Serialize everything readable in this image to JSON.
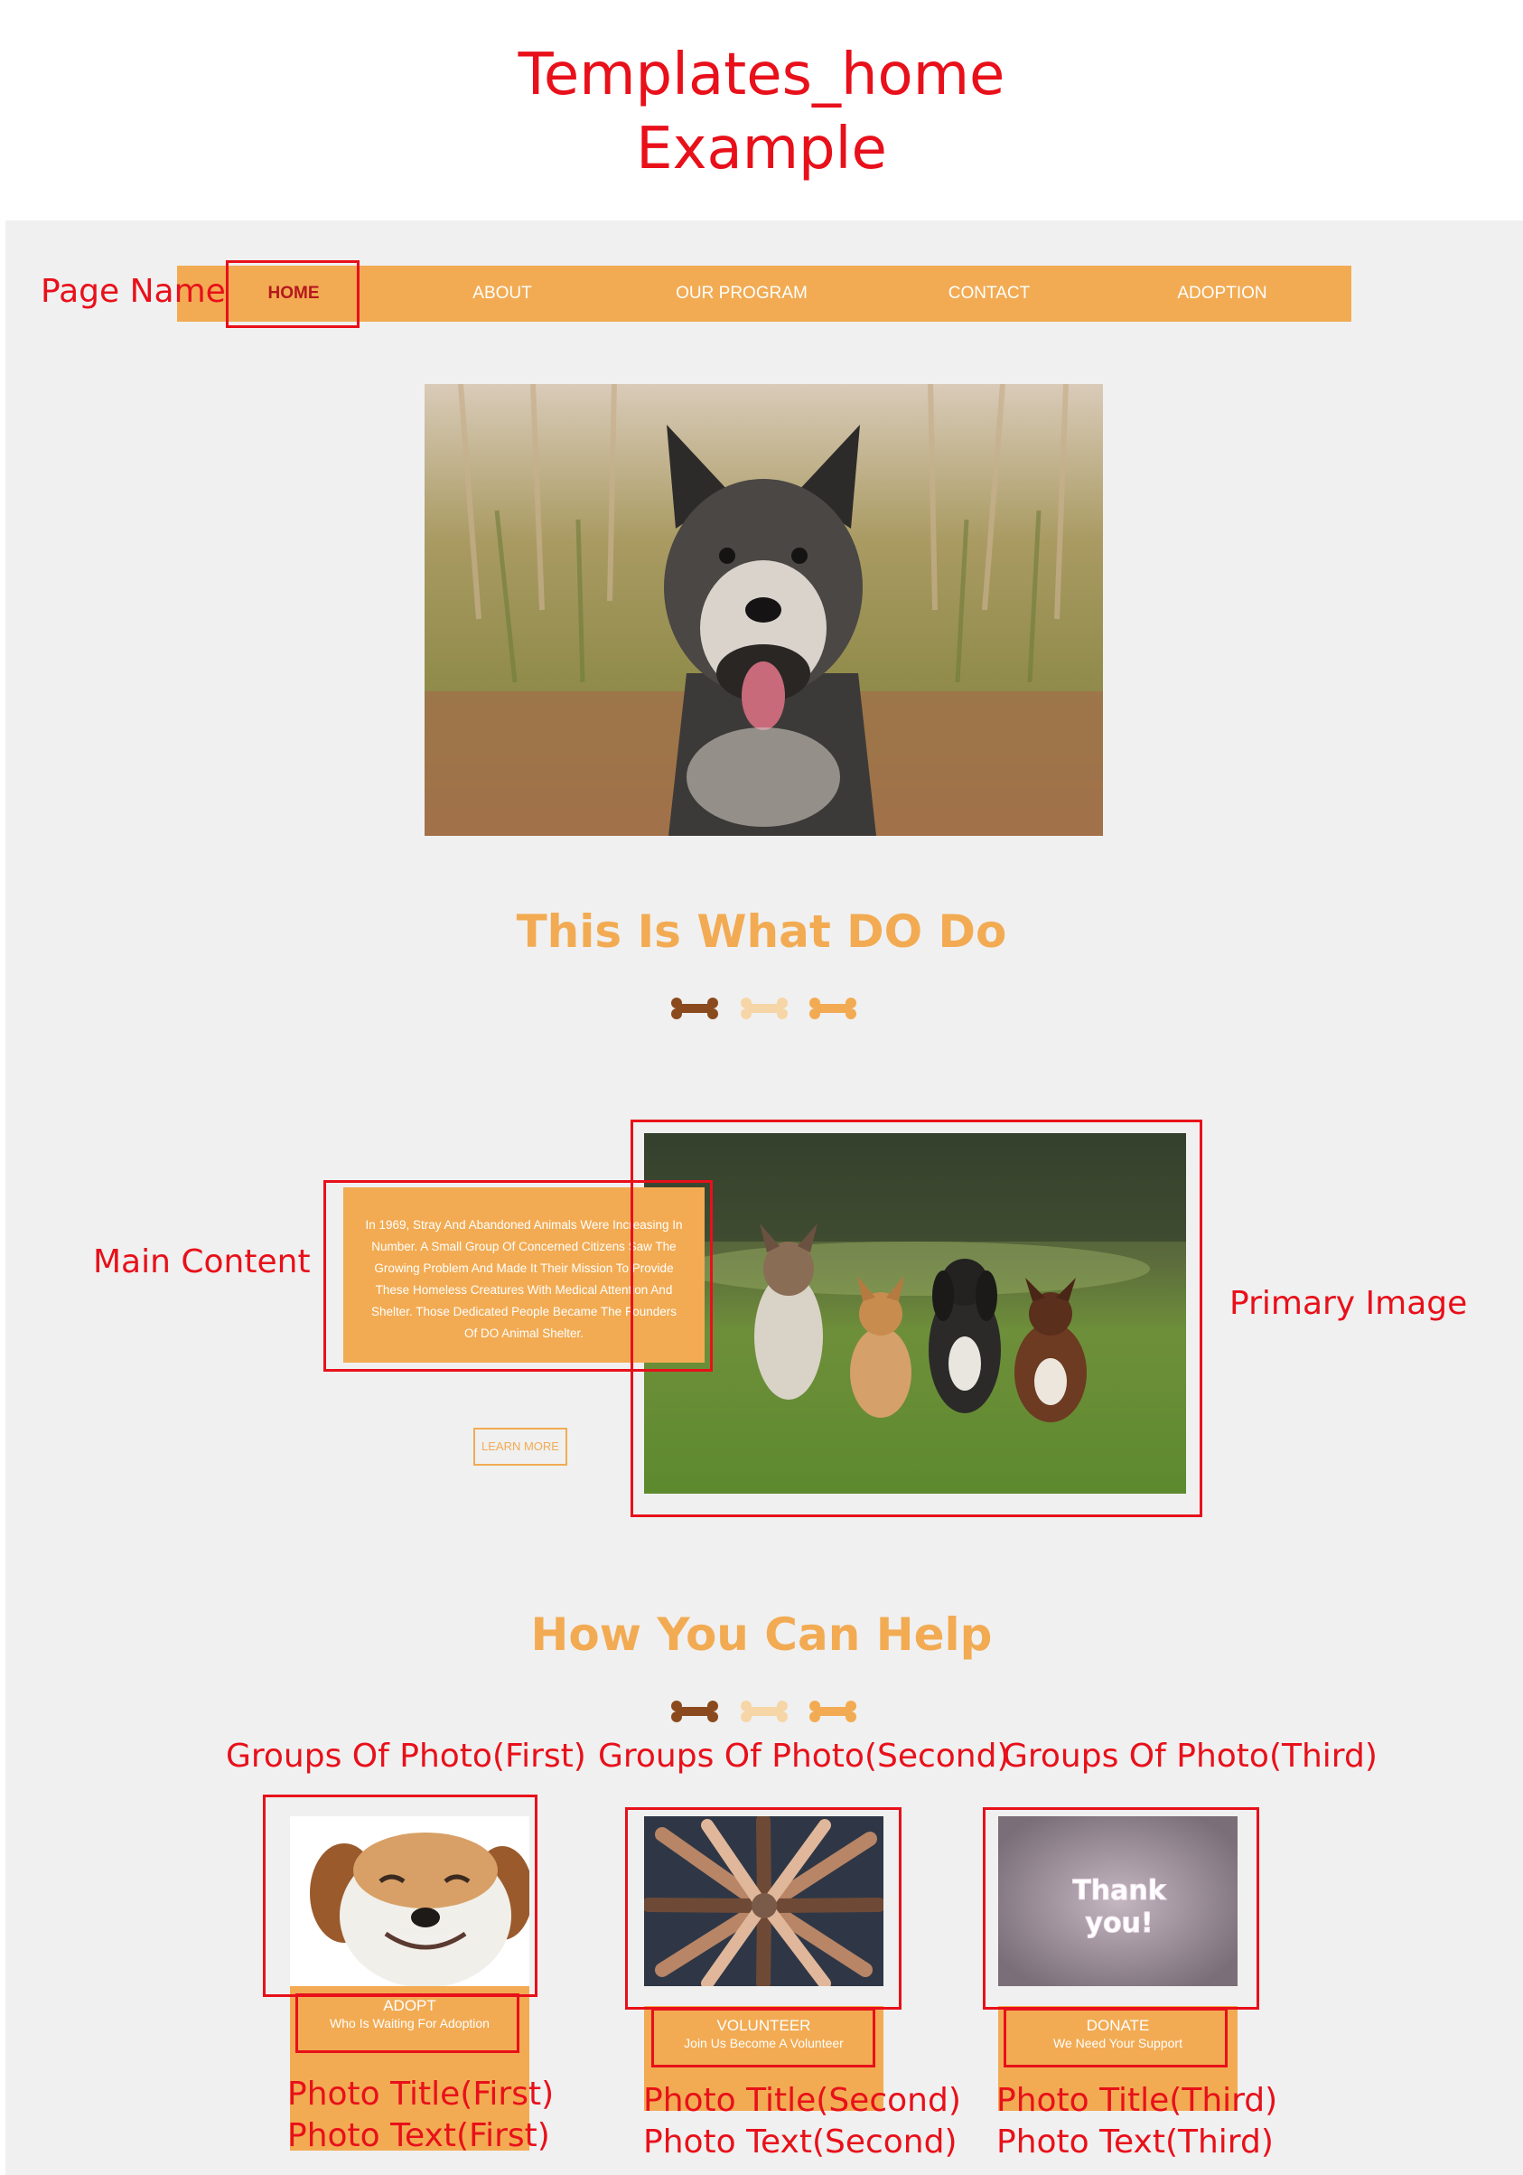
{
  "doc": {
    "title_line1": "Templates_home",
    "title_line2": "Example"
  },
  "annotations": {
    "page_name": "Page Name",
    "main_content": "Main Content",
    "primary_image": "Primary Image",
    "group_first": "Groups Of Photo(First)",
    "group_second": "Groups Of Photo(Second)",
    "group_third": "Groups Of Photo(Third)",
    "photo_title_first": "Photo Title(First)",
    "photo_text_first": "Photo Text(First)",
    "photo_title_second": "Photo Title(Second)",
    "photo_text_second": "Photo Text(Second)",
    "photo_title_third": "Photo Title(Third)",
    "photo_text_third": "Photo Text(Third)"
  },
  "nav": {
    "items": [
      {
        "label": "HOME",
        "active": true
      },
      {
        "label": "ABOUT",
        "active": false
      },
      {
        "label": "OUR PROGRAM",
        "active": false
      },
      {
        "label": "CONTACT",
        "active": false
      },
      {
        "label": "ADOPTION",
        "active": false
      }
    ]
  },
  "hero": {
    "image": "senior-dog-photo"
  },
  "section1": {
    "title": "This Is What DO Do",
    "paragraph": "In 1969, Stray And Abandoned Animals Were Increasing In Number. A Small Group Of Concerned Citizens Saw The Growing Problem And Made It Their Mission To Provide These Homeless Creatures With Medical Attention And Shelter. Those Dedicated People Became The Founders Of DO Animal Shelter.",
    "button": "LEARN MORE",
    "image": "four-dogs-on-grass-photo"
  },
  "section2": {
    "title": "How You Can Help",
    "cards": [
      {
        "title": "ADOPT",
        "text": "Who Is Waiting For Adoption",
        "image": "smiling-dog-photo"
      },
      {
        "title": "VOLUNTEER",
        "text": "Join Us Become A Volunteer",
        "image": "hands-together-photo"
      },
      {
        "title": "DONATE",
        "text": "We Need Your Support",
        "image": "thank-you-neon-photo"
      }
    ]
  },
  "colors": {
    "accent": "#f2ab53",
    "annotation": "#e8101a",
    "active_nav": "#b5181d",
    "bone_dark": "#8b4a1d",
    "bone_light": "#f6d6a6",
    "page_bg": "#f0f0f0"
  }
}
